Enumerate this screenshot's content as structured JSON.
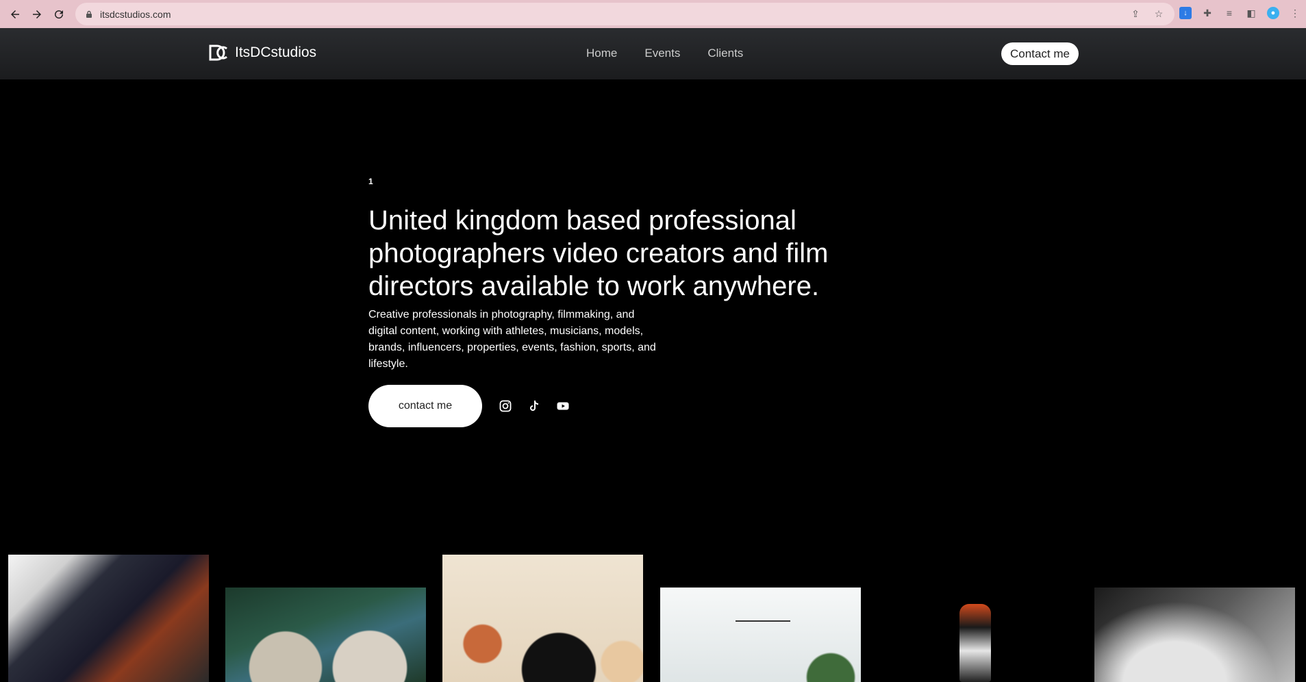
{
  "browser": {
    "url": "itsdcstudios.com"
  },
  "site": {
    "brand": "ItsDCstudios",
    "nav": [
      "Home",
      "Events",
      "Clients"
    ],
    "header_cta": "Contact me"
  },
  "hero": {
    "index": "1",
    "title": "United kingdom based professional photographers video creators and film directors available to work anywhere.",
    "subtitle": "Creative professionals in photography, filmmaking, and digital content, working with athletes, musicians, models, brands, influencers, properties, events, fashion, sports, and lifestyle.",
    "cta": "contact me",
    "social_icons": [
      "instagram-icon",
      "tiktok-icon",
      "youtube-icon"
    ]
  },
  "gallery": {
    "items": [
      "car-interior-photo",
      "portrait-photo",
      "wedding-photo",
      "interior-photo",
      "sneaker-photo",
      "stage-photo"
    ]
  },
  "colors": {
    "chrome": "#e7c3cb",
    "header": "#232427",
    "background": "#000000",
    "button": "#ffffff"
  }
}
